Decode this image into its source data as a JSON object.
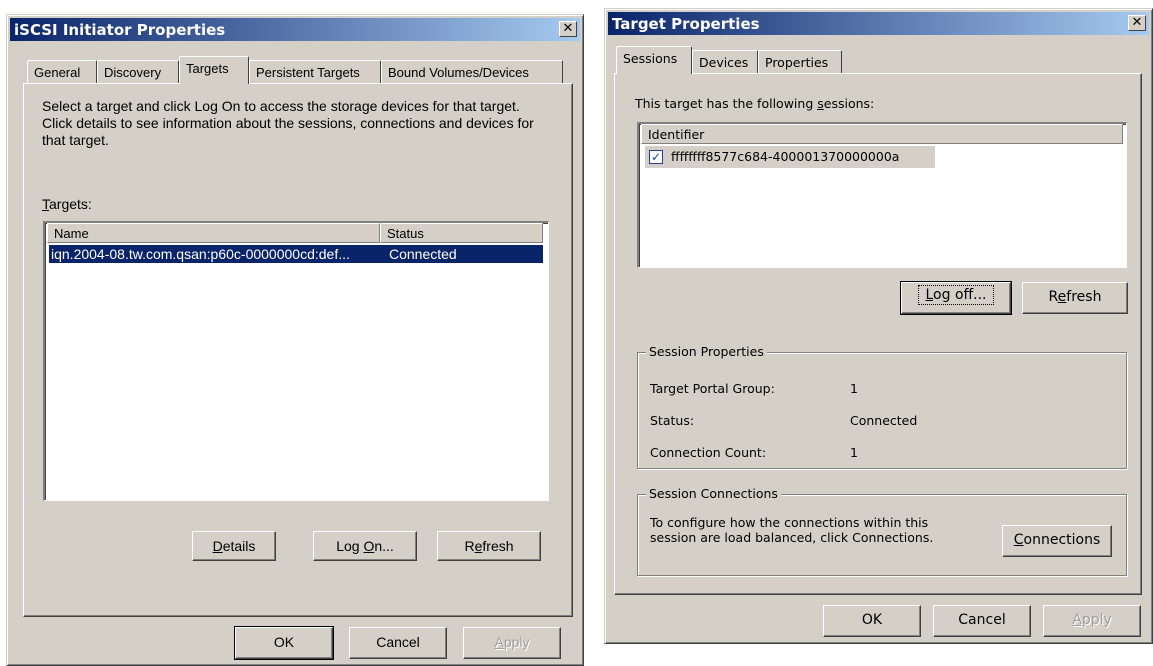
{
  "left_dialog": {
    "title": "iSCSI Initiator Properties",
    "tabs": [
      {
        "label": "General",
        "active": false
      },
      {
        "label": "Discovery",
        "active": false
      },
      {
        "label": "Targets",
        "active": true
      },
      {
        "label": "Persistent Targets",
        "active": false
      },
      {
        "label": "Bound Volumes/Devices",
        "active": false
      }
    ],
    "description": "Select a target and click Log On to access the storage devices for that target. Click details to see information about the sessions, connections and devices for that target.",
    "targets_label_mnemonic": "T",
    "targets_label_rest": "argets:",
    "columns": {
      "name": "Name",
      "status": "Status"
    },
    "rows": [
      {
        "name": "iqn.2004-08.tw.com.qsan:p60c-0000000cd:def...",
        "status": "Connected",
        "selected": true
      }
    ],
    "buttons": {
      "details_mnemonic": "D",
      "details_rest": "etails",
      "logon_pre": "Log ",
      "logon_mnemonic": "O",
      "logon_rest": "n...",
      "refresh_pre": "R",
      "refresh_mnemonic": "e",
      "refresh_rest": "fresh",
      "ok": "OK",
      "cancel": "Cancel",
      "apply_mnemonic": "A",
      "apply_rest": "pply"
    }
  },
  "right_dialog": {
    "title": "Target Properties",
    "tabs": [
      {
        "label": "Sessions",
        "active": true
      },
      {
        "label": "Devices",
        "active": false
      },
      {
        "label": "Properties",
        "active": false
      }
    ],
    "sessions_intro_pre": "This target has the following ",
    "sessions_intro_mnemonic": "s",
    "sessions_intro_rest": "essions:",
    "identifier_header": "Identifier",
    "sessions": [
      {
        "identifier": "ffffffff8577c684-400001370000000a",
        "checked": true
      }
    ],
    "buttons": {
      "logoff_mnemonic": "L",
      "logoff_rest": "og off...",
      "refresh_pre": "R",
      "refresh_mnemonic": "e",
      "refresh_rest": "fresh",
      "connections_mnemonic": "C",
      "connections_rest": "onnections",
      "ok": "OK",
      "cancel": "Cancel",
      "apply_mnemonic": "A",
      "apply_rest": "pply"
    },
    "session_properties": {
      "title": "Session Properties",
      "target_portal_group_label": "Target Portal Group:",
      "target_portal_group_value": "1",
      "status_label": "Status:",
      "status_value": "Connected",
      "connection_count_label": "Connection Count:",
      "connection_count_value": "1"
    },
    "session_connections": {
      "title": "Session Connections",
      "text": "To configure how the connections within this session are load balanced, click Connections."
    }
  },
  "colors": {
    "dialog_bg": "#d4d0c8",
    "title_gradient_start": "#0a246a",
    "title_gradient_end": "#a6caf0",
    "selection": "#0a246a"
  }
}
